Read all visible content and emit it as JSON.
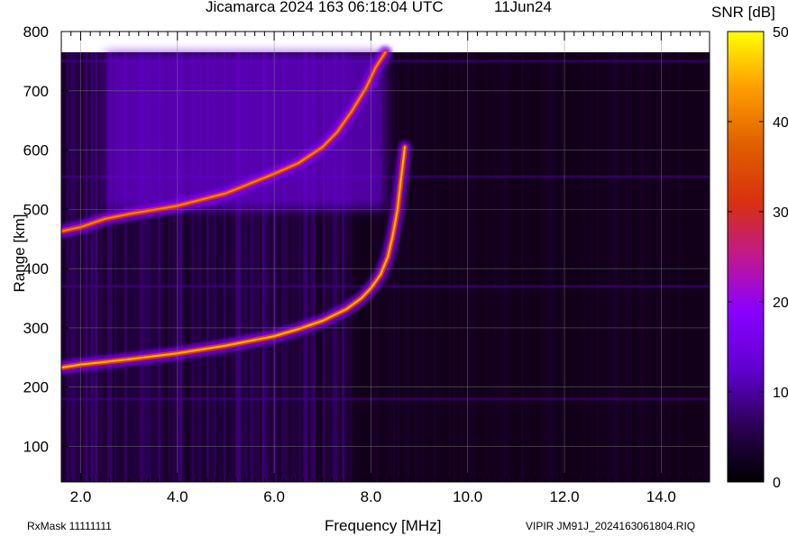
{
  "chart_data": {
    "type": "heatmap",
    "title": "Jicamarca 2024 163 06:18:04 UTC",
    "date_label": "11Jun24",
    "xlabel": "Frequency [MHz]",
    "ylabel": "Range [km]",
    "xlim": [
      1.6,
      15.0
    ],
    "ylim": [
      40,
      800
    ],
    "x_ticks": [
      2.0,
      4.0,
      6.0,
      8.0,
      10.0,
      12.0,
      14.0
    ],
    "x_tick_labels": [
      "2.0",
      "4.0",
      "6.0",
      "8.0",
      "10.0",
      "12.0",
      "14.0"
    ],
    "y_ticks": [
      100,
      200,
      300,
      400,
      500,
      600,
      700,
      800
    ],
    "y_tick_labels": [
      "100",
      "200",
      "300",
      "400",
      "500",
      "600",
      "700",
      "800"
    ],
    "grid": true,
    "data_range_top_km": 765,
    "colorbar": {
      "title": "SNR [dB]",
      "range": [
        0,
        50
      ],
      "ticks": [
        0,
        10,
        20,
        30,
        40,
        50
      ],
      "tick_labels": [
        "0",
        "10",
        "20",
        "30",
        "40",
        "50"
      ],
      "colors": [
        "#000000",
        "#3a006e",
        "#7a00ff",
        "#d02090",
        "#e06000",
        "#ffa000",
        "#ffff00"
      ]
    },
    "traces": [
      {
        "name": "",
        "points": [
          [
            1.6,
            233
          ],
          [
            2.0,
            238
          ],
          [
            3.0,
            247
          ],
          [
            4.0,
            257
          ],
          [
            5.0,
            270
          ],
          [
            6.0,
            286
          ],
          [
            6.5,
            298
          ],
          [
            7.0,
            312
          ],
          [
            7.5,
            332
          ],
          [
            7.8,
            350
          ],
          [
            8.0,
            367
          ],
          [
            8.2,
            390
          ],
          [
            8.35,
            420
          ],
          [
            8.45,
            455
          ],
          [
            8.55,
            500
          ],
          [
            8.62,
            550
          ],
          [
            8.7,
            605
          ]
        ],
        "peak_snr": 46
      },
      {
        "name": "",
        "points": [
          [
            1.6,
            463
          ],
          [
            2.0,
            470
          ],
          [
            2.5,
            484
          ],
          [
            3.0,
            492
          ],
          [
            4.0,
            506
          ],
          [
            5.0,
            527
          ],
          [
            6.0,
            560
          ],
          [
            6.5,
            578
          ],
          [
            7.0,
            605
          ],
          [
            7.3,
            630
          ],
          [
            7.6,
            665
          ],
          [
            7.9,
            705
          ],
          [
            8.1,
            740
          ],
          [
            8.3,
            765
          ]
        ],
        "peak_snr": 42
      }
    ],
    "diffuse_region": {
      "freq": [
        2.5,
        8.3
      ],
      "range": [
        500,
        765
      ],
      "snr": 14
    },
    "interference_rows_km": [
      180,
      370,
      555,
      750
    ]
  },
  "footer": {
    "left": "RxMask 11111111",
    "right": "VIPIR  JM91J_2024163061804.RIQ"
  }
}
